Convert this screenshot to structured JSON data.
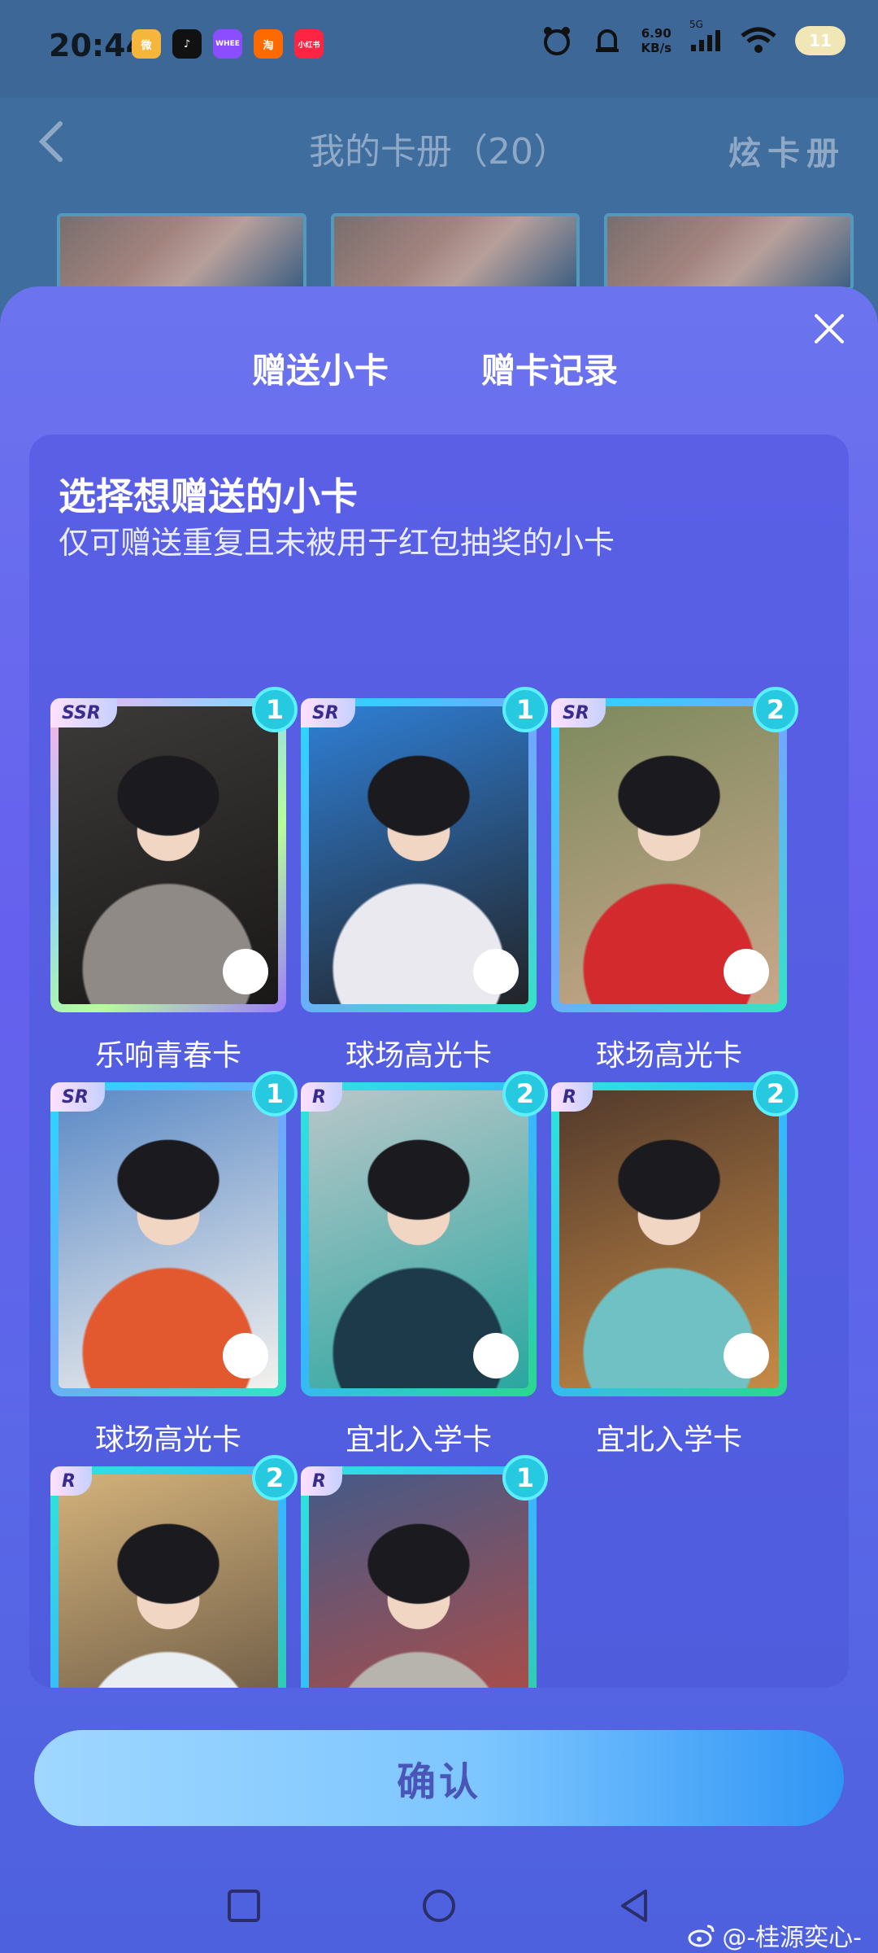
{
  "status_bar": {
    "time": "20:44",
    "net_speed_value": "6.90",
    "net_speed_unit": "KB/s",
    "signal_label": "5G",
    "battery": "11",
    "apps": [
      {
        "name": "weibo-icon",
        "color": "#f6b63b",
        "text": "微"
      },
      {
        "name": "tiktok-icon",
        "color": "#111111",
        "text": "♪"
      },
      {
        "name": "whee-icon",
        "color": "#8a4dff",
        "text": "WHEE"
      },
      {
        "name": "taobao-icon",
        "color": "#ff6a00",
        "text": "淘"
      },
      {
        "name": "xiaohongshu-icon",
        "color": "#ff2442",
        "text": "小红书"
      }
    ]
  },
  "top_nav": {
    "title": "我的卡册（20）",
    "right_action": "炫卡册"
  },
  "modal": {
    "tabs": [
      {
        "label": "赠送小卡",
        "active": true
      },
      {
        "label": "赠卡记录",
        "active": false
      }
    ],
    "panel_title": "选择想赠送的小卡",
    "panel_subtitle": "仅可赠送重复且未被用于红包抽奖的小卡",
    "cards": [
      {
        "rarity": "SSR",
        "count": "1",
        "label": "乐响青春卡",
        "colors": [
          "#3b3a38",
          "#8f8a86",
          "#1a1816"
        ]
      },
      {
        "rarity": "SR",
        "count": "1",
        "label": "球场高光卡",
        "colors": [
          "#2f7fd6",
          "#e9e9ef",
          "#222427"
        ]
      },
      {
        "rarity": "SR",
        "count": "2",
        "label": "球场高光卡",
        "colors": [
          "#7d8a5e",
          "#d32a2e",
          "#c9a78b"
        ]
      },
      {
        "rarity": "SR",
        "count": "1",
        "label": "球场高光卡",
        "colors": [
          "#5b8ac6",
          "#e2592f",
          "#f3f1ee"
        ]
      },
      {
        "rarity": "R",
        "count": "2",
        "label": "宜北入学卡",
        "colors": [
          "#b9c6c9",
          "#1d3a4a",
          "#2aa7a0"
        ]
      },
      {
        "rarity": "R",
        "count": "2",
        "label": "宜北入学卡",
        "colors": [
          "#523a2c",
          "#6fc1c4",
          "#c68a46"
        ]
      },
      {
        "rarity": "R",
        "count": "2",
        "label": "",
        "colors": [
          "#d3b27a",
          "#e9eef2",
          "#5a4b3d"
        ]
      },
      {
        "rarity": "R",
        "count": "1",
        "label": "",
        "colors": [
          "#445a88",
          "#b7b3ad",
          "#c24a3a"
        ]
      }
    ],
    "confirm_label": "确认"
  },
  "watermark": "@-桂源奕心-",
  "colors": {
    "accent": "#27c9e0",
    "modal_bg": "#6560ee",
    "confirm_text": "#4a55b8"
  }
}
